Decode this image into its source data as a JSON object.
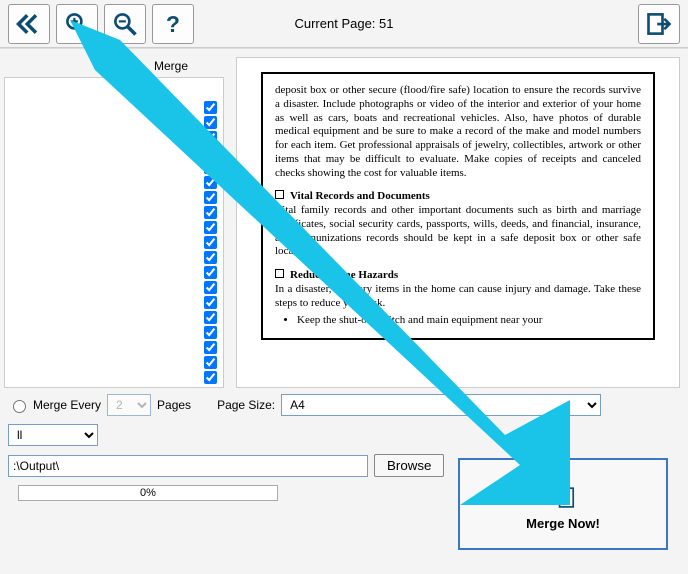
{
  "toolbar": {
    "current_page_label": "Current Page:",
    "current_page_number": "51"
  },
  "left": {
    "header": "Merge",
    "check_count": 19
  },
  "preview": {
    "para1": "deposit box or other secure (flood/fire safe) location to ensure the records survive a disaster. Include photographs or video of the interior and exterior of your home as well as cars, boats and recreational vehicles. Also, have photos of durable medical equipment and be sure to make a record of the make and model numbers for each item. Get professional appraisals of jewelry, collectibles, artwork or other items that may be difficult to evaluate. Make copies of receipts and canceled checks showing the cost for valuable items.",
    "sec1_title": "Vital Records and Documents",
    "sec1_body": "Vital family records and other important documents such as birth and marriage certificates, social security cards, passports, wills, deeds, and financial, insurance, and immunizations records should be kept in a safe deposit box or other safe location.",
    "sec2_title": "Reduce Home Hazards",
    "sec2_body": "In a disaster, ordinary items in the home can cause injury and damage. Take these steps to reduce your risk.",
    "bullet1": "Keep the shut-off switch and main equipment near your"
  },
  "controls": {
    "merge_every_label": "Merge Every",
    "merge_every_value": "2",
    "pages_label": "Pages",
    "page_size_label": "Page Size:",
    "page_size_value": "A4",
    "dropdown2_value": "ll",
    "output_value": ":\\Output\\",
    "browse_label": "Browse",
    "progress_text": "0%"
  },
  "merge_button": {
    "label": "Merge Now!"
  }
}
